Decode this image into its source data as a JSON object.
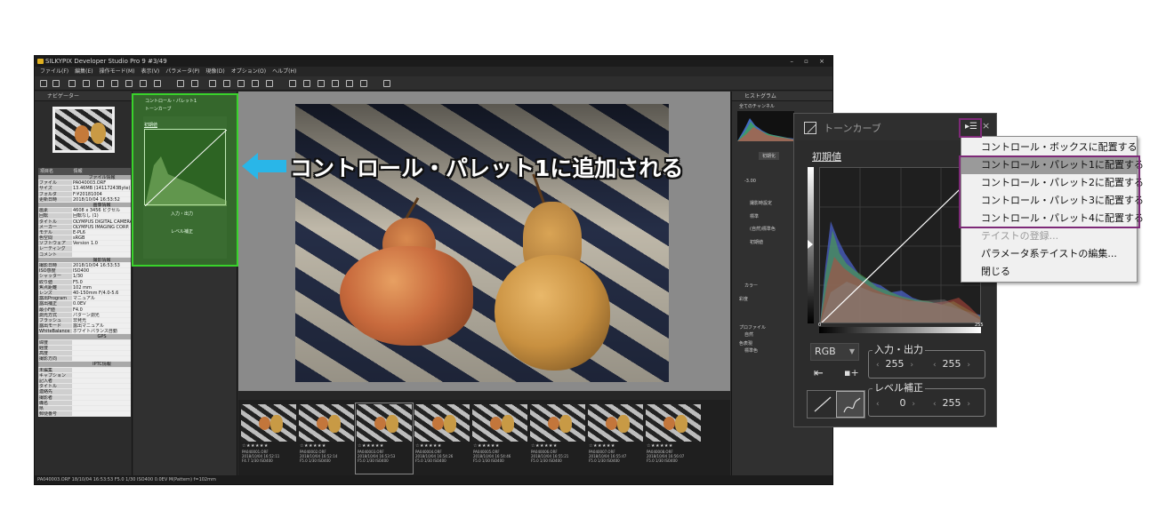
{
  "window": {
    "title": "SILKYPIX Developer Studio Pro 9   #3/49",
    "controls": "– ▫ ×",
    "menu": [
      "ファイル(F)",
      "編集(E)",
      "操作モード(M)",
      "表示(V)",
      "パラメータ(P)",
      "現像(D)",
      "オプション(O)",
      "ヘルプ(H)"
    ]
  },
  "left_panel": {
    "navigator_title": "ナビゲーター",
    "info_columns": [
      "項目名",
      "情報"
    ],
    "info_rows": [
      {
        "k": "",
        "v": "ファイル情報",
        "sec": true
      },
      {
        "k": "ファイル",
        "v": "PA040003.ORF"
      },
      {
        "k": "サイズ",
        "v": "13.46MB (14117243Byte)"
      },
      {
        "k": "フォルダ",
        "v": "F:¥20181004"
      },
      {
        "k": "更新日時",
        "v": "2018/10/04 16:53:52"
      },
      {
        "k": "",
        "v": "画像情報",
        "sec": true
      },
      {
        "k": "画素",
        "v": "4608 x 3456 ピクセル"
      },
      {
        "k": "回転",
        "v": "回転なし (1)"
      },
      {
        "k": "タイトル",
        "v": "OLYMPUS DIGITAL CAMERA"
      },
      {
        "k": "メーカー",
        "v": "OLYMPUS IMAGING CORP."
      },
      {
        "k": "モデル",
        "v": "E-PL6"
      },
      {
        "k": "色空間",
        "v": "sRGB"
      },
      {
        "k": "ソフトウェア",
        "v": "Version 1.0"
      },
      {
        "k": "レーティング",
        "v": ""
      },
      {
        "k": "コメント",
        "v": ""
      },
      {
        "k": "",
        "v": "撮影情報",
        "sec": true
      },
      {
        "k": "撮影日時",
        "v": "2018/10/04 16:53:53"
      },
      {
        "k": "ISO感度",
        "v": "ISO400"
      },
      {
        "k": "シャッター",
        "v": "1/30"
      },
      {
        "k": "絞り値",
        "v": "F5.0"
      },
      {
        "k": "焦点距離",
        "v": "102 mm"
      },
      {
        "k": "レンズ",
        "v": "40-150mm F/4.0-5.6"
      },
      {
        "k": "露出Program",
        "v": "マニュアル"
      },
      {
        "k": "露出補正",
        "v": "0.0EV"
      },
      {
        "k": "最小F値",
        "v": "F4.0"
      },
      {
        "k": "測光方式",
        "v": "パターン測光"
      },
      {
        "k": "フラッシュ",
        "v": "非発光"
      },
      {
        "k": "露出モード",
        "v": "露出マニュアル"
      },
      {
        "k": "WhiteBalance",
        "v": "ホワイトバランス自動"
      },
      {
        "k": "",
        "v": "GPS",
        "sec": true
      },
      {
        "k": "緯度",
        "v": ""
      },
      {
        "k": "経度",
        "v": ""
      },
      {
        "k": "高度",
        "v": ""
      },
      {
        "k": "撮影方向",
        "v": ""
      },
      {
        "k": "",
        "v": "IPTC情報",
        "sec": true
      },
      {
        "k": "未編集",
        "v": ""
      },
      {
        "k": "キャプション",
        "v": ""
      },
      {
        "k": "記入者",
        "v": ""
      },
      {
        "k": "タイトル",
        "v": ""
      },
      {
        "k": "連絡先",
        "v": ""
      },
      {
        "k": "撮影者",
        "v": ""
      },
      {
        "k": "職名",
        "v": ""
      },
      {
        "k": "県",
        "v": ""
      },
      {
        "k": "郵便番号",
        "v": ""
      }
    ]
  },
  "control_palette": {
    "title": "コントロール・パレット1",
    "subtitle": "トーンカーブ",
    "preset": "初期値",
    "io_label": "入力・出力",
    "level_label": "レベル補正"
  },
  "right_panel": {
    "histogram_title": "ヒストグラム",
    "channel": "全てのチャンネル",
    "initial_btn": "初期化",
    "ev_value": "-3.00",
    "items": [
      "撮影時設定",
      "標準",
      "(自然)標準色",
      "初期値"
    ],
    "color_label": "カラー",
    "saturation_label": "彩度",
    "profile_label": "プロファイル",
    "profile_value": "自然",
    "color_system_label": "色表現",
    "color_system_value": "標準色"
  },
  "filmstrip": {
    "stars": "☆★★★★★",
    "items": [
      {
        "file": "PA040001.ORF",
        "date": "2018/10/04 16:52:11",
        "exif": "F4.7 1/30 ISO400"
      },
      {
        "file": "PA040002.ORF",
        "date": "2018/10/04 16:52:14",
        "exif": "F5.0 1/30 ISO400"
      },
      {
        "file": "PA040003.ORF",
        "date": "2018/10/04 16:53:53",
        "exif": "F5.0 1/30 ISO400"
      },
      {
        "file": "PA040004.ORF",
        "date": "2018/10/04 16:54:26",
        "exif": "F5.0 1/30 ISO400"
      },
      {
        "file": "PA040005.ORF",
        "date": "2018/10/04 16:54:46",
        "exif": "F5.0 1/30 ISO400"
      },
      {
        "file": "PA040006.ORF",
        "date": "2018/10/04 16:55:21",
        "exif": "F5.0 1/30 ISO400"
      },
      {
        "file": "PA040007.ORF",
        "date": "2018/10/04 16:55:47",
        "exif": "F5.0 1/30 ISO400"
      },
      {
        "file": "PA040008.ORF",
        "date": "2018/10/04 16:56:07",
        "exif": "F5.0 1/30 ISO400"
      }
    ]
  },
  "statusbar": "PA040003.ORF 18/10/04 16:53:53 F5.0 1/30 ISO400  0.0EV M(Pattern) f=102mm",
  "caption": "コントロール・パレット1に追加される",
  "tone_curve": {
    "title": "トーンカーブ",
    "menu_icon": "▸☰",
    "close": "×",
    "preset": "初期値",
    "handle_low": "0",
    "handle_high": "255",
    "channel": "RGB",
    "io_label": "入力・出力",
    "io_in": "255",
    "io_out": "255",
    "level_label": "レベル補正",
    "level_low": "0",
    "level_high": "255"
  },
  "popup_menu": {
    "items": [
      {
        "label": "コントロール・ボックスに配置する",
        "state": "normal"
      },
      {
        "label": "コントロール・パレット1に配置する",
        "state": "highlighted"
      },
      {
        "label": "コントロール・パレット2に配置する",
        "state": "normal"
      },
      {
        "label": "コントロール・パレット3に配置する",
        "state": "normal"
      },
      {
        "label": "コントロール・パレット4に配置する",
        "state": "normal"
      },
      {
        "label": "テイストの登録...",
        "state": "disabled"
      },
      {
        "label": "パラメータ系テイストの編集...",
        "state": "normal"
      },
      {
        "label": "閉じる",
        "state": "normal"
      }
    ]
  },
  "colors": {
    "highlight_green": "#39d22b",
    "arrow_cyan": "#29b6e8",
    "menu_frame": "#7e2a78"
  }
}
